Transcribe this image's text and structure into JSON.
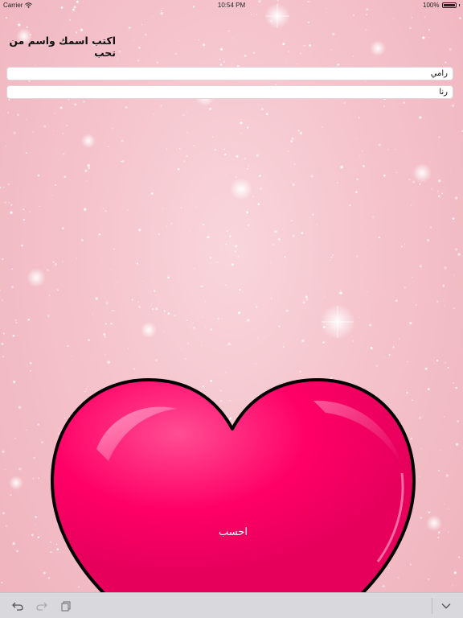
{
  "status_bar": {
    "carrier": "Carrier",
    "time": "10:54 PM",
    "battery_text": "100%",
    "battery_level": 1.0
  },
  "form": {
    "prompt": "اكتب اسمك واسم من تحب",
    "name_one": "رامي",
    "name_two": "رنا"
  },
  "calculate_button": {
    "label": "احسب"
  },
  "colors": {
    "background": "#f5c3cc",
    "heart": "#ff0066",
    "heart_outline": "#000000",
    "toolbar": "#d9d9dd"
  },
  "toolbar": {
    "icons": [
      "undo-icon",
      "redo-icon",
      "clipboard-icon",
      "chevron-down-icon"
    ]
  }
}
